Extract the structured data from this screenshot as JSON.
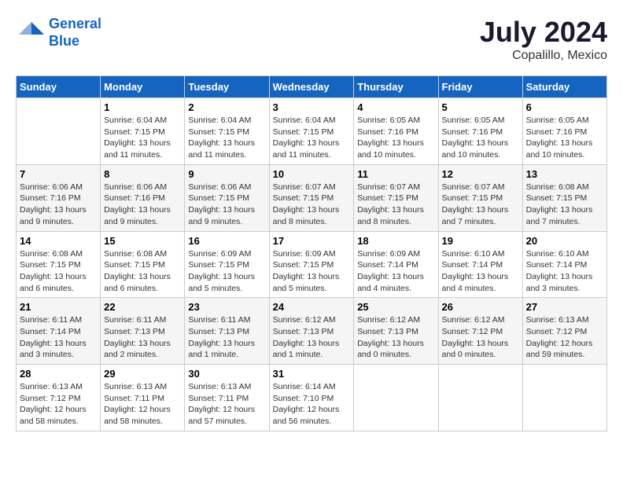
{
  "header": {
    "logo_line1": "General",
    "logo_line2": "Blue",
    "month_year": "July 2024",
    "location": "Copalillo, Mexico"
  },
  "days_of_week": [
    "Sunday",
    "Monday",
    "Tuesday",
    "Wednesday",
    "Thursday",
    "Friday",
    "Saturday"
  ],
  "weeks": [
    [
      {
        "day": "",
        "info": ""
      },
      {
        "day": "1",
        "info": "Sunrise: 6:04 AM\nSunset: 7:15 PM\nDaylight: 13 hours\nand 11 minutes."
      },
      {
        "day": "2",
        "info": "Sunrise: 6:04 AM\nSunset: 7:15 PM\nDaylight: 13 hours\nand 11 minutes."
      },
      {
        "day": "3",
        "info": "Sunrise: 6:04 AM\nSunset: 7:15 PM\nDaylight: 13 hours\nand 11 minutes."
      },
      {
        "day": "4",
        "info": "Sunrise: 6:05 AM\nSunset: 7:16 PM\nDaylight: 13 hours\nand 10 minutes."
      },
      {
        "day": "5",
        "info": "Sunrise: 6:05 AM\nSunset: 7:16 PM\nDaylight: 13 hours\nand 10 minutes."
      },
      {
        "day": "6",
        "info": "Sunrise: 6:05 AM\nSunset: 7:16 PM\nDaylight: 13 hours\nand 10 minutes."
      }
    ],
    [
      {
        "day": "7",
        "info": "Sunrise: 6:06 AM\nSunset: 7:16 PM\nDaylight: 13 hours\nand 9 minutes."
      },
      {
        "day": "8",
        "info": "Sunrise: 6:06 AM\nSunset: 7:16 PM\nDaylight: 13 hours\nand 9 minutes."
      },
      {
        "day": "9",
        "info": "Sunrise: 6:06 AM\nSunset: 7:15 PM\nDaylight: 13 hours\nand 9 minutes."
      },
      {
        "day": "10",
        "info": "Sunrise: 6:07 AM\nSunset: 7:15 PM\nDaylight: 13 hours\nand 8 minutes."
      },
      {
        "day": "11",
        "info": "Sunrise: 6:07 AM\nSunset: 7:15 PM\nDaylight: 13 hours\nand 8 minutes."
      },
      {
        "day": "12",
        "info": "Sunrise: 6:07 AM\nSunset: 7:15 PM\nDaylight: 13 hours\nand 7 minutes."
      },
      {
        "day": "13",
        "info": "Sunrise: 6:08 AM\nSunset: 7:15 PM\nDaylight: 13 hours\nand 7 minutes."
      }
    ],
    [
      {
        "day": "14",
        "info": "Sunrise: 6:08 AM\nSunset: 7:15 PM\nDaylight: 13 hours\nand 6 minutes."
      },
      {
        "day": "15",
        "info": "Sunrise: 6:08 AM\nSunset: 7:15 PM\nDaylight: 13 hours\nand 6 minutes."
      },
      {
        "day": "16",
        "info": "Sunrise: 6:09 AM\nSunset: 7:15 PM\nDaylight: 13 hours\nand 5 minutes."
      },
      {
        "day": "17",
        "info": "Sunrise: 6:09 AM\nSunset: 7:15 PM\nDaylight: 13 hours\nand 5 minutes."
      },
      {
        "day": "18",
        "info": "Sunrise: 6:09 AM\nSunset: 7:14 PM\nDaylight: 13 hours\nand 4 minutes."
      },
      {
        "day": "19",
        "info": "Sunrise: 6:10 AM\nSunset: 7:14 PM\nDaylight: 13 hours\nand 4 minutes."
      },
      {
        "day": "20",
        "info": "Sunrise: 6:10 AM\nSunset: 7:14 PM\nDaylight: 13 hours\nand 3 minutes."
      }
    ],
    [
      {
        "day": "21",
        "info": "Sunrise: 6:11 AM\nSunset: 7:14 PM\nDaylight: 13 hours\nand 3 minutes."
      },
      {
        "day": "22",
        "info": "Sunrise: 6:11 AM\nSunset: 7:13 PM\nDaylight: 13 hours\nand 2 minutes."
      },
      {
        "day": "23",
        "info": "Sunrise: 6:11 AM\nSunset: 7:13 PM\nDaylight: 13 hours\nand 1 minute."
      },
      {
        "day": "24",
        "info": "Sunrise: 6:12 AM\nSunset: 7:13 PM\nDaylight: 13 hours\nand 1 minute."
      },
      {
        "day": "25",
        "info": "Sunrise: 6:12 AM\nSunset: 7:13 PM\nDaylight: 13 hours\nand 0 minutes."
      },
      {
        "day": "26",
        "info": "Sunrise: 6:12 AM\nSunset: 7:12 PM\nDaylight: 13 hours\nand 0 minutes."
      },
      {
        "day": "27",
        "info": "Sunrise: 6:13 AM\nSunset: 7:12 PM\nDaylight: 12 hours\nand 59 minutes."
      }
    ],
    [
      {
        "day": "28",
        "info": "Sunrise: 6:13 AM\nSunset: 7:12 PM\nDaylight: 12 hours\nand 58 minutes."
      },
      {
        "day": "29",
        "info": "Sunrise: 6:13 AM\nSunset: 7:11 PM\nDaylight: 12 hours\nand 58 minutes."
      },
      {
        "day": "30",
        "info": "Sunrise: 6:13 AM\nSunset: 7:11 PM\nDaylight: 12 hours\nand 57 minutes."
      },
      {
        "day": "31",
        "info": "Sunrise: 6:14 AM\nSunset: 7:10 PM\nDaylight: 12 hours\nand 56 minutes."
      },
      {
        "day": "",
        "info": ""
      },
      {
        "day": "",
        "info": ""
      },
      {
        "day": "",
        "info": ""
      }
    ]
  ]
}
